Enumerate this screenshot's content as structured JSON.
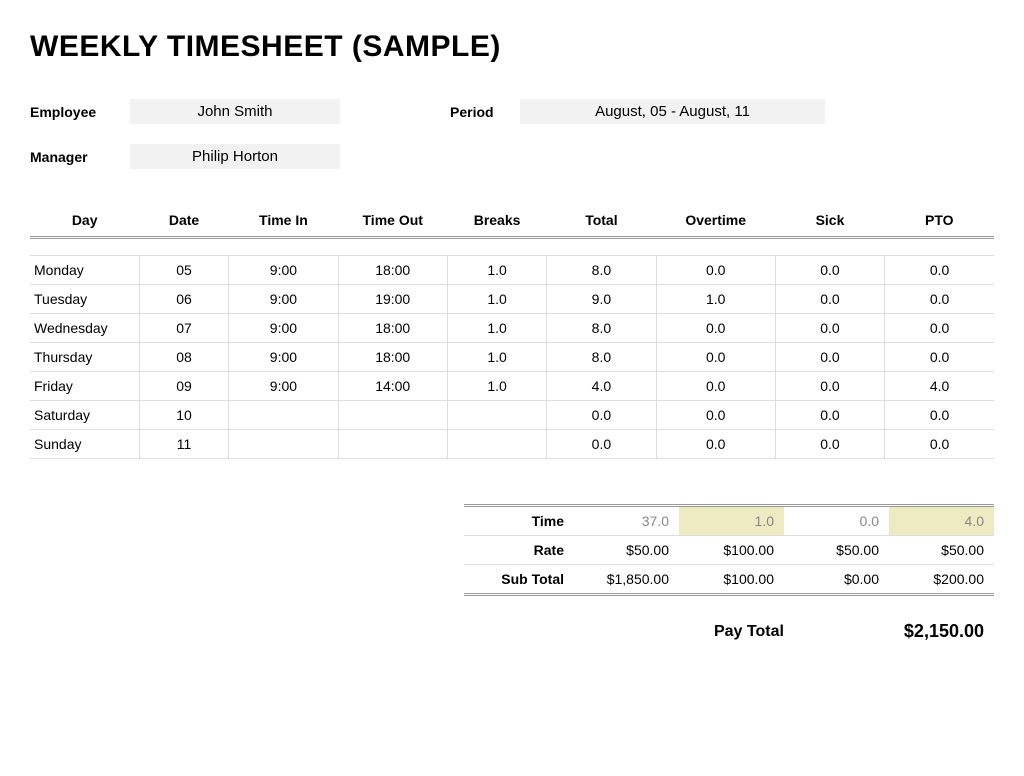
{
  "title": "WEEKLY TIMESHEET (SAMPLE)",
  "meta": {
    "employee_label": "Employee",
    "employee_value": "John Smith",
    "period_label": "Period",
    "period_value": "August, 05 - August, 11",
    "manager_label": "Manager",
    "manager_value": "Philip Horton"
  },
  "columns": {
    "day": "Day",
    "date": "Date",
    "time_in": "Time In",
    "time_out": "Time Out",
    "breaks": "Breaks",
    "total": "Total",
    "overtime": "Overtime",
    "sick": "Sick",
    "pto": "PTO"
  },
  "rows": [
    {
      "day": "Monday",
      "date": "05",
      "in": "9:00",
      "out": "18:00",
      "breaks": "1.0",
      "total": "8.0",
      "ot": "0.0",
      "sick": "0.0",
      "pto": "0.0"
    },
    {
      "day": "Tuesday",
      "date": "06",
      "in": "9:00",
      "out": "19:00",
      "breaks": "1.0",
      "total": "9.0",
      "ot": "1.0",
      "sick": "0.0",
      "pto": "0.0"
    },
    {
      "day": "Wednesday",
      "date": "07",
      "in": "9:00",
      "out": "18:00",
      "breaks": "1.0",
      "total": "8.0",
      "ot": "0.0",
      "sick": "0.0",
      "pto": "0.0"
    },
    {
      "day": "Thursday",
      "date": "08",
      "in": "9:00",
      "out": "18:00",
      "breaks": "1.0",
      "total": "8.0",
      "ot": "0.0",
      "sick": "0.0",
      "pto": "0.0"
    },
    {
      "day": "Friday",
      "date": "09",
      "in": "9:00",
      "out": "14:00",
      "breaks": "1.0",
      "total": "4.0",
      "ot": "0.0",
      "sick": "0.0",
      "pto": "4.0"
    },
    {
      "day": "Saturday",
      "date": "10",
      "in": "",
      "out": "",
      "breaks": "",
      "total": "0.0",
      "ot": "0.0",
      "sick": "0.0",
      "pto": "0.0"
    },
    {
      "day": "Sunday",
      "date": "11",
      "in": "",
      "out": "",
      "breaks": "",
      "total": "0.0",
      "ot": "0.0",
      "sick": "0.0",
      "pto": "0.0"
    }
  ],
  "summary": {
    "labels": {
      "time": "Time",
      "rate": "Rate",
      "subtotal": "Sub Total"
    },
    "time": {
      "total": "37.0",
      "ot": "1.0",
      "sick": "0.0",
      "pto": "4.0"
    },
    "rate": {
      "total": "$50.00",
      "ot": "$100.00",
      "sick": "$50.00",
      "pto": "$50.00"
    },
    "subtotal": {
      "total": "$1,850.00",
      "ot": "$100.00",
      "sick": "$0.00",
      "pto": "$200.00"
    }
  },
  "pay_total": {
    "label": "Pay Total",
    "value": "$2,150.00"
  }
}
